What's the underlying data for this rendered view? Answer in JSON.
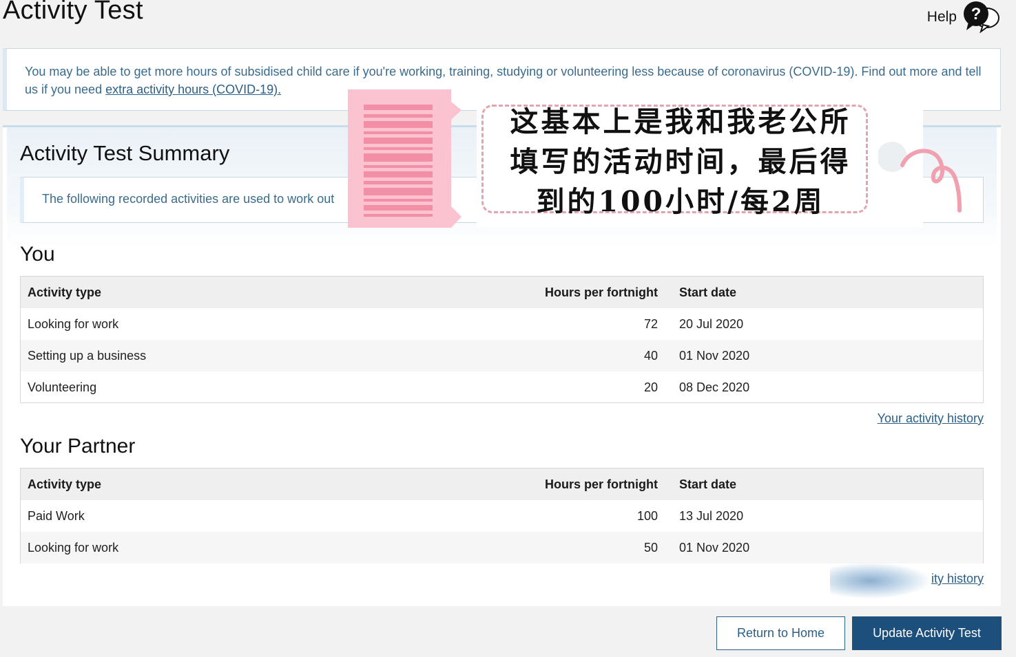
{
  "page": {
    "title": "Activity Test"
  },
  "help": {
    "label": "Help",
    "icon": "question-bubble-icon"
  },
  "notice": {
    "text": "You may be able to get more hours of subsidised child care if you're working, training, studying or volunteering less because of coronavirus (COVID-19). Find out more and tell us if you need ",
    "link": "extra activity hours (COVID-19)."
  },
  "summary": {
    "title": "Activity Test Summary",
    "info": "The following recorded activities are used to work out"
  },
  "you": {
    "heading": "You",
    "columns": [
      "Activity type",
      "Hours per fortnight",
      "Start date"
    ],
    "rows": [
      [
        "Looking for work",
        "72",
        "20 Jul 2020"
      ],
      [
        "Setting up a business",
        "40",
        "01 Nov 2020"
      ],
      [
        "Volunteering",
        "20",
        "08 Dec 2020"
      ]
    ],
    "history_link": "Your activity history"
  },
  "partner": {
    "heading": "Your Partner",
    "columns": [
      "Activity type",
      "Hours per fortnight",
      "Start date"
    ],
    "rows": [
      [
        "Paid Work",
        "100",
        "13 Jul 2020"
      ],
      [
        "Looking for work",
        "50",
        "01 Nov 2020"
      ]
    ],
    "history_link": "ity history"
  },
  "buttons": {
    "home": "Return to Home",
    "update": "Update Activity Test"
  },
  "overlay_note": {
    "line1": "这基本上是我和我老公所",
    "line2": "填写的活动时间，最后得",
    "line3": "到的100小时/每2周"
  },
  "colors": {
    "brand_blue": "#1c4f7c",
    "link_blue": "#2b5f86",
    "sticker_pink": "#fbc3cf"
  }
}
